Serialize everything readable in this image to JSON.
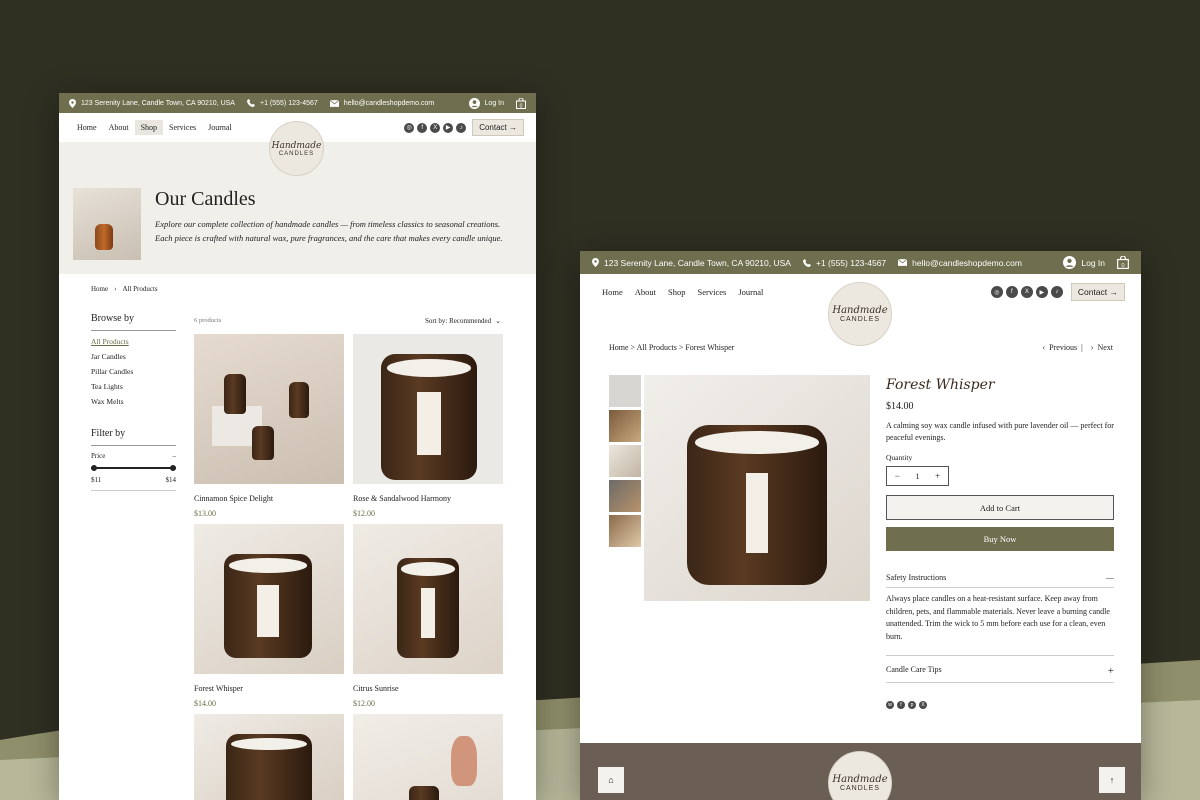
{
  "topbar": {
    "address": "123 Serenity Lane, Candle Town, CA 90210, USA",
    "phone": "+1 (555) 123-4567",
    "email": "hello@candleshopdemo.com",
    "login": "Log In"
  },
  "nav": {
    "home": "Home",
    "about": "About",
    "shop": "Shop",
    "services": "Services",
    "journal": "Journal",
    "contact": "Contact →"
  },
  "logo": {
    "script": "Handmade",
    "caps": "CANDLES"
  },
  "shop_page": {
    "title": "Our Candles",
    "intro": "Explore our complete collection of handmade candles — from timeless classics to seasonal creations. Each piece is crafted with natural wax, pure fragrances, and the care that makes every candle unique.",
    "breadcrumb_home": "Home",
    "breadcrumb_current": "All Products",
    "product_count": "6 products",
    "sort_label": "Sort by: Recommended",
    "browse_heading": "Browse by",
    "categories": [
      "All Products",
      "Jar Candles",
      "Pillar Candles",
      "Tea Lights",
      "Wax Melts"
    ],
    "filter_heading": "Filter by",
    "price_label": "Price",
    "price_min": "$11",
    "price_max": "$14",
    "products": [
      {
        "name": "Cinnamon Spice Delight",
        "price": "$13.00"
      },
      {
        "name": "Rose & Sandalwood Harmony",
        "price": "$12.00"
      },
      {
        "name": "Forest Whisper",
        "price": "$14.00"
      },
      {
        "name": "Citrus Sunrise",
        "price": "$12.00"
      }
    ]
  },
  "product_page": {
    "breadcrumb": "Home > All Products > Forest Whisper",
    "previous": "Previous",
    "next": "Next",
    "name": "Forest Whisper",
    "price": "$14.00",
    "description": "A calming soy wax candle infused with pure lavender oil — perfect for peaceful evenings.",
    "quantity_label": "Quantity",
    "quantity_value": "1",
    "add_to_cart": "Add to Cart",
    "buy_now": "Buy Now",
    "safety_title": "Safety Instructions",
    "safety_text": "Always place candles on a heat-resistant surface. Keep away from children, pets, and flammable materials. Never leave a burning candle unattended. Trim the wick to 5 mm before each use for a clean, even burn.",
    "care_title": "Candle Care Tips"
  },
  "colors": {
    "olive": "#6f6e4e",
    "dark_bg": "#2f2f22",
    "footer": "#6b5e54",
    "cream": "#f1efea"
  }
}
